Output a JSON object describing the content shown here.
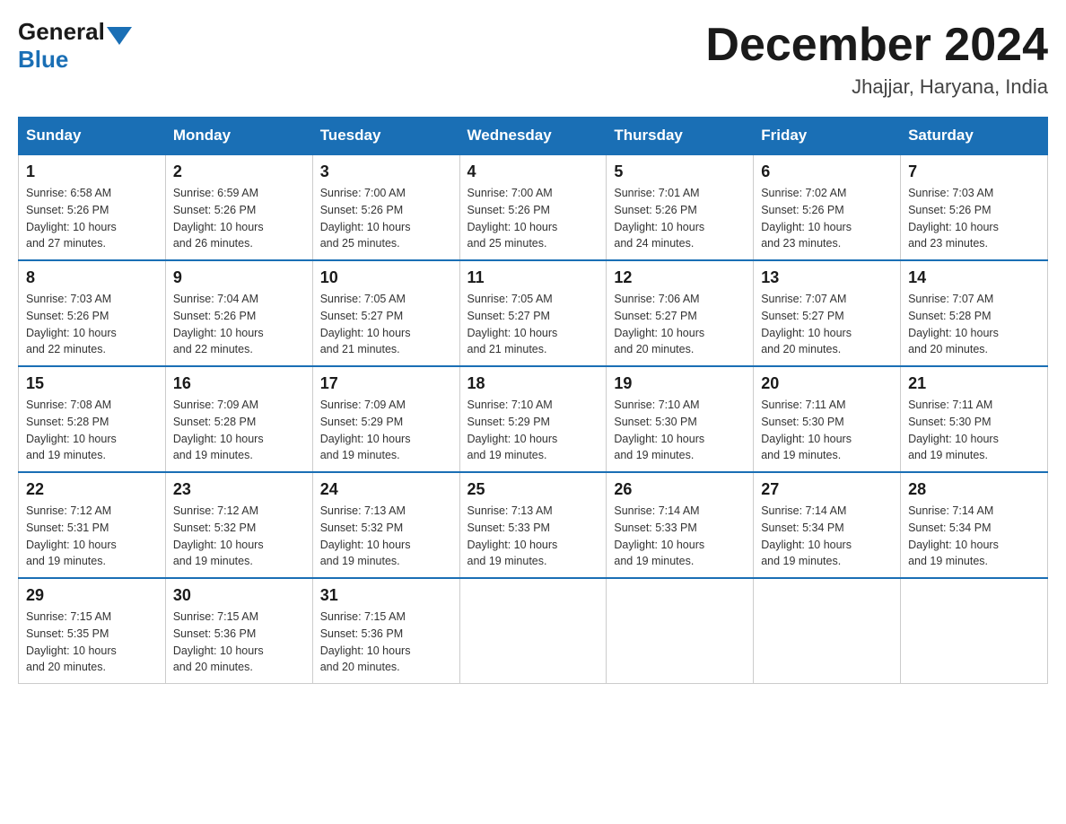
{
  "header": {
    "logo_general": "General",
    "logo_blue": "Blue",
    "month_title": "December 2024",
    "location": "Jhajjar, Haryana, India"
  },
  "weekdays": [
    "Sunday",
    "Monday",
    "Tuesday",
    "Wednesday",
    "Thursday",
    "Friday",
    "Saturday"
  ],
  "weeks": [
    [
      {
        "day": "1",
        "sunrise": "6:58 AM",
        "sunset": "5:26 PM",
        "daylight": "10 hours and 27 minutes."
      },
      {
        "day": "2",
        "sunrise": "6:59 AM",
        "sunset": "5:26 PM",
        "daylight": "10 hours and 26 minutes."
      },
      {
        "day": "3",
        "sunrise": "7:00 AM",
        "sunset": "5:26 PM",
        "daylight": "10 hours and 25 minutes."
      },
      {
        "day": "4",
        "sunrise": "7:00 AM",
        "sunset": "5:26 PM",
        "daylight": "10 hours and 25 minutes."
      },
      {
        "day": "5",
        "sunrise": "7:01 AM",
        "sunset": "5:26 PM",
        "daylight": "10 hours and 24 minutes."
      },
      {
        "day": "6",
        "sunrise": "7:02 AM",
        "sunset": "5:26 PM",
        "daylight": "10 hours and 23 minutes."
      },
      {
        "day": "7",
        "sunrise": "7:03 AM",
        "sunset": "5:26 PM",
        "daylight": "10 hours and 23 minutes."
      }
    ],
    [
      {
        "day": "8",
        "sunrise": "7:03 AM",
        "sunset": "5:26 PM",
        "daylight": "10 hours and 22 minutes."
      },
      {
        "day": "9",
        "sunrise": "7:04 AM",
        "sunset": "5:26 PM",
        "daylight": "10 hours and 22 minutes."
      },
      {
        "day": "10",
        "sunrise": "7:05 AM",
        "sunset": "5:27 PM",
        "daylight": "10 hours and 21 minutes."
      },
      {
        "day": "11",
        "sunrise": "7:05 AM",
        "sunset": "5:27 PM",
        "daylight": "10 hours and 21 minutes."
      },
      {
        "day": "12",
        "sunrise": "7:06 AM",
        "sunset": "5:27 PM",
        "daylight": "10 hours and 20 minutes."
      },
      {
        "day": "13",
        "sunrise": "7:07 AM",
        "sunset": "5:27 PM",
        "daylight": "10 hours and 20 minutes."
      },
      {
        "day": "14",
        "sunrise": "7:07 AM",
        "sunset": "5:28 PM",
        "daylight": "10 hours and 20 minutes."
      }
    ],
    [
      {
        "day": "15",
        "sunrise": "7:08 AM",
        "sunset": "5:28 PM",
        "daylight": "10 hours and 19 minutes."
      },
      {
        "day": "16",
        "sunrise": "7:09 AM",
        "sunset": "5:28 PM",
        "daylight": "10 hours and 19 minutes."
      },
      {
        "day": "17",
        "sunrise": "7:09 AM",
        "sunset": "5:29 PM",
        "daylight": "10 hours and 19 minutes."
      },
      {
        "day": "18",
        "sunrise": "7:10 AM",
        "sunset": "5:29 PM",
        "daylight": "10 hours and 19 minutes."
      },
      {
        "day": "19",
        "sunrise": "7:10 AM",
        "sunset": "5:30 PM",
        "daylight": "10 hours and 19 minutes."
      },
      {
        "day": "20",
        "sunrise": "7:11 AM",
        "sunset": "5:30 PM",
        "daylight": "10 hours and 19 minutes."
      },
      {
        "day": "21",
        "sunrise": "7:11 AM",
        "sunset": "5:30 PM",
        "daylight": "10 hours and 19 minutes."
      }
    ],
    [
      {
        "day": "22",
        "sunrise": "7:12 AM",
        "sunset": "5:31 PM",
        "daylight": "10 hours and 19 minutes."
      },
      {
        "day": "23",
        "sunrise": "7:12 AM",
        "sunset": "5:32 PM",
        "daylight": "10 hours and 19 minutes."
      },
      {
        "day": "24",
        "sunrise": "7:13 AM",
        "sunset": "5:32 PM",
        "daylight": "10 hours and 19 minutes."
      },
      {
        "day": "25",
        "sunrise": "7:13 AM",
        "sunset": "5:33 PM",
        "daylight": "10 hours and 19 minutes."
      },
      {
        "day": "26",
        "sunrise": "7:14 AM",
        "sunset": "5:33 PM",
        "daylight": "10 hours and 19 minutes."
      },
      {
        "day": "27",
        "sunrise": "7:14 AM",
        "sunset": "5:34 PM",
        "daylight": "10 hours and 19 minutes."
      },
      {
        "day": "28",
        "sunrise": "7:14 AM",
        "sunset": "5:34 PM",
        "daylight": "10 hours and 19 minutes."
      }
    ],
    [
      {
        "day": "29",
        "sunrise": "7:15 AM",
        "sunset": "5:35 PM",
        "daylight": "10 hours and 20 minutes."
      },
      {
        "day": "30",
        "sunrise": "7:15 AM",
        "sunset": "5:36 PM",
        "daylight": "10 hours and 20 minutes."
      },
      {
        "day": "31",
        "sunrise": "7:15 AM",
        "sunset": "5:36 PM",
        "daylight": "10 hours and 20 minutes."
      },
      null,
      null,
      null,
      null
    ]
  ],
  "labels": {
    "sunrise": "Sunrise:",
    "sunset": "Sunset:",
    "daylight": "Daylight:"
  }
}
